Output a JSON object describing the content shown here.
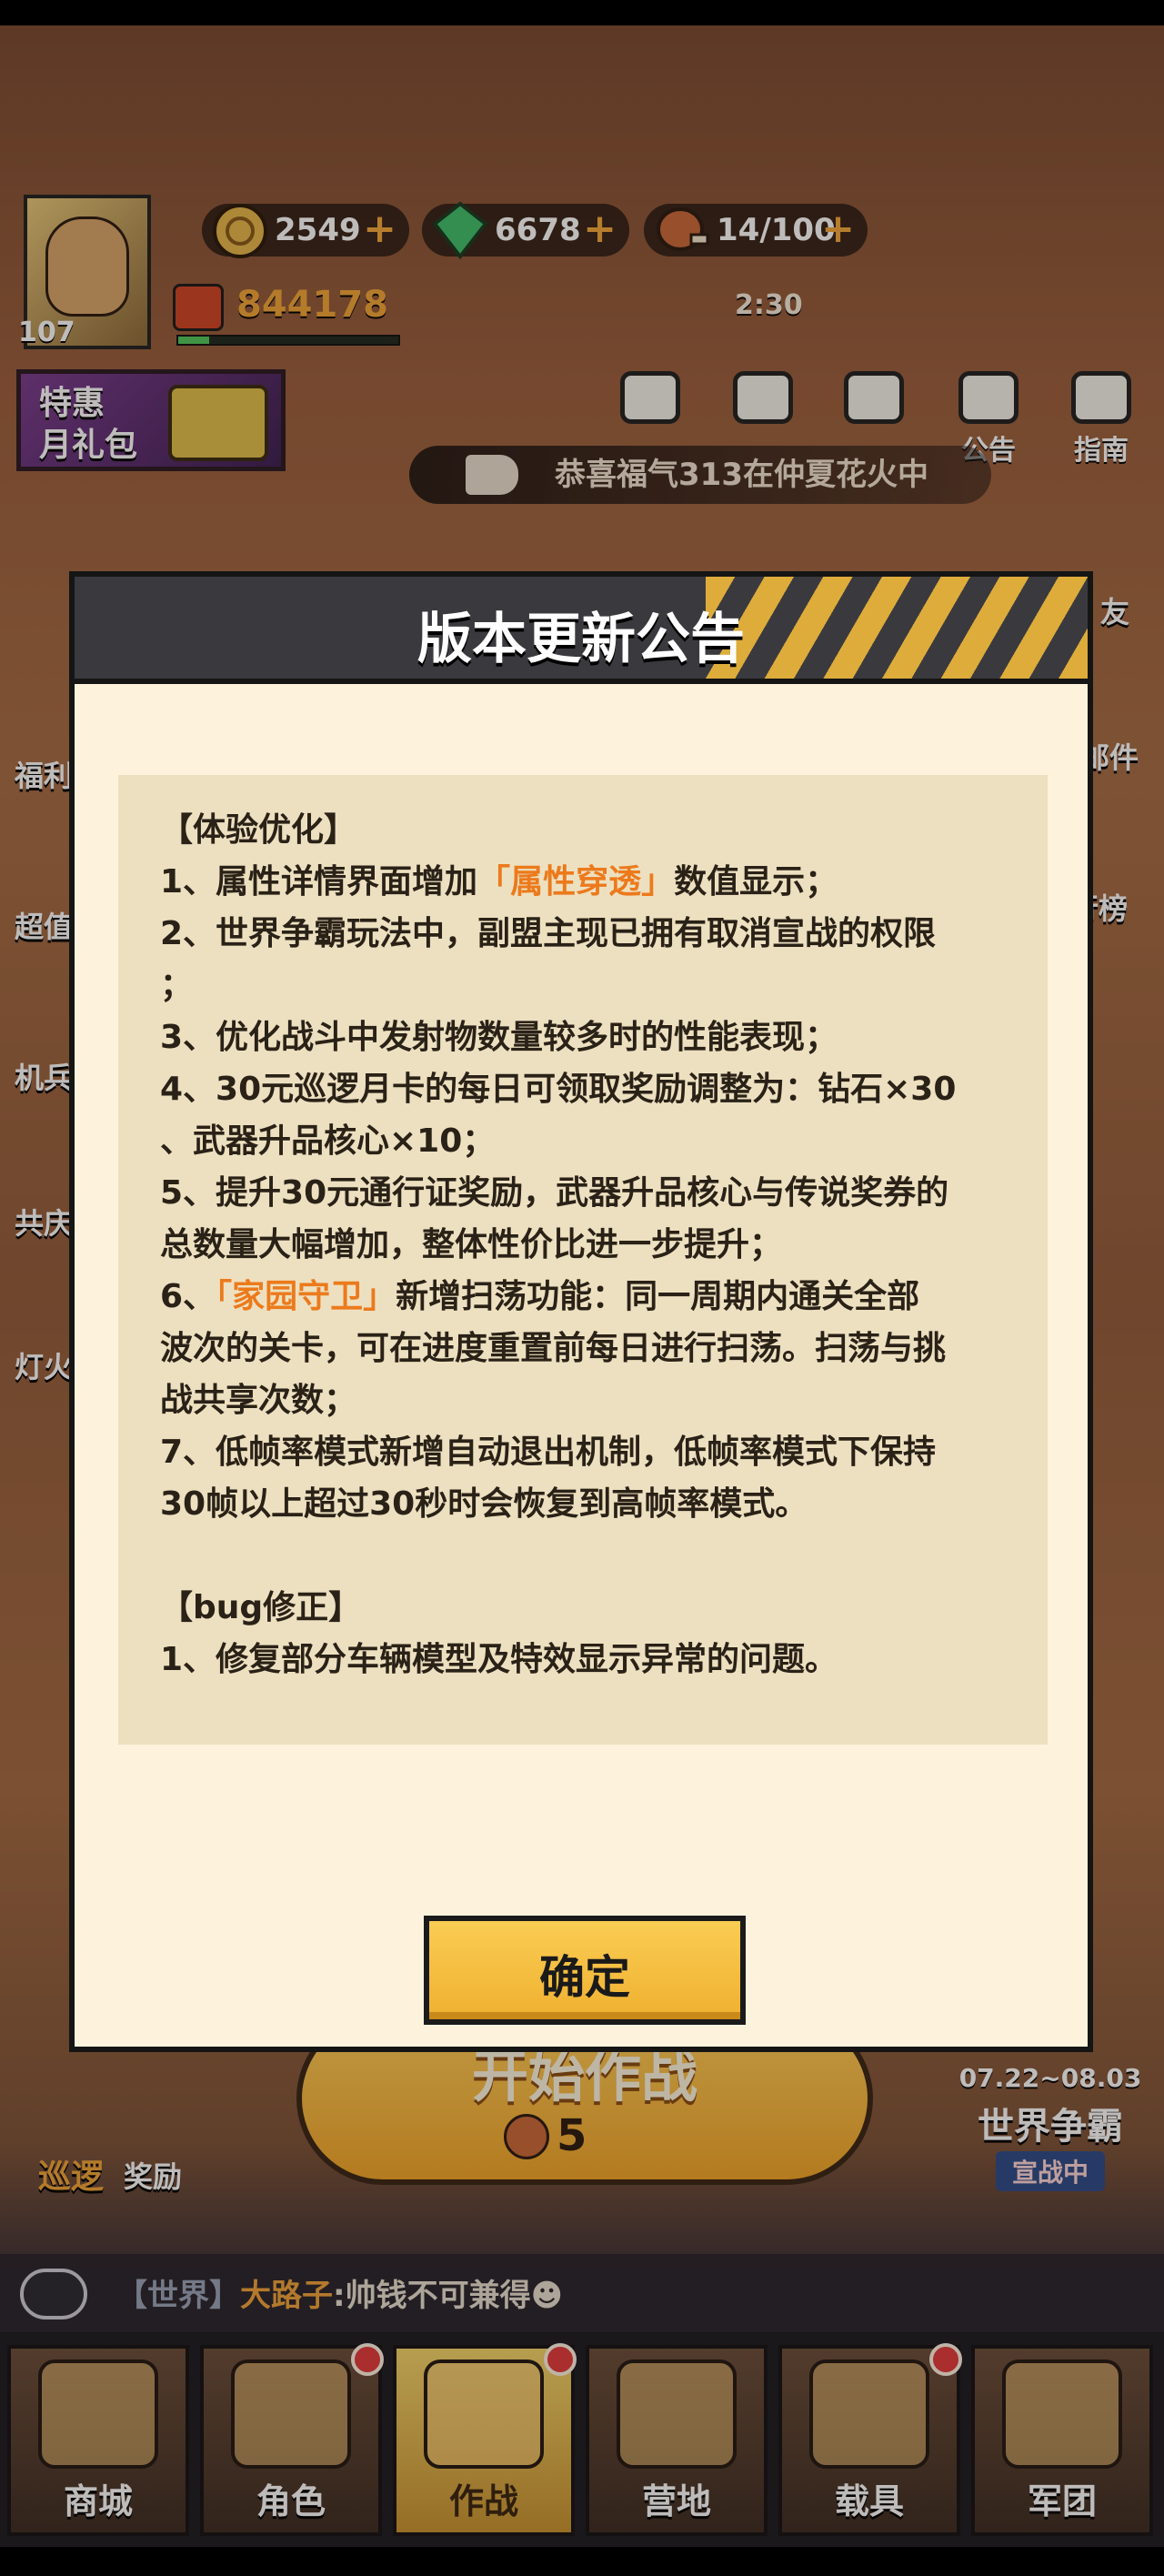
{
  "hud": {
    "player_level": "107",
    "coins": "2549",
    "gems": "6678",
    "stamina": "14/100",
    "stamina_timer": "2:30",
    "combat_power": "844178",
    "exp_fraction": 0.14,
    "plus_symbol": "+"
  },
  "gift_pack": {
    "label": "特惠\n月礼包"
  },
  "top_icons": [
    {
      "label": "",
      "icon": "pack-icon"
    },
    {
      "label": "",
      "icon": "backpack-icon"
    },
    {
      "label": "",
      "icon": "gamepad-icon"
    },
    {
      "label": "公告",
      "icon": "megaphone-icon"
    },
    {
      "label": "指南",
      "icon": "guide-icon"
    }
  ],
  "ticker": {
    "prefix": "恭喜福气313在仲夏花火中",
    "icon": "speaker-icon"
  },
  "side_left": [
    "福利",
    "超值",
    "机兵",
    "共庆",
    "灯火"
  ],
  "side_right": [
    "友",
    "邮件",
    "行榜"
  ],
  "modal": {
    "title": "版本更新公告",
    "lines": [
      {
        "text": "【体验优化】"
      },
      {
        "pre": "1、属性详情界面增加",
        "hl": "「属性穿透」",
        "post": "数值显示；"
      },
      {
        "text": "2、世界争霸玩法中，副盟主现已拥有取消宣战的权限"
      },
      {
        "text": "；"
      },
      {
        "text": "3、优化战斗中发射物数量较多时的性能表现；"
      },
      {
        "text": "4、30元巡逻月卡的每日可领取奖励调整为：钻石×30"
      },
      {
        "text": "、武器升品核心×10；"
      },
      {
        "text": "5、提升30元通行证奖励，武器升品核心与传说奖券的"
      },
      {
        "text": "总数量大幅增加，整体性价比进一步提升；"
      },
      {
        "pre": "6、",
        "hl": "「家园守卫」",
        "post": "新增扫荡功能：同一周期内通关全部"
      },
      {
        "text": "波次的关卡，可在进度重置前每日进行扫荡。扫荡与挑"
      },
      {
        "text": "战共享次数；"
      },
      {
        "text": "7、低帧率模式新增自动退出机制，低帧率模式下保持"
      },
      {
        "text": "30帧以上超过30秒时会恢复到高帧率模式。"
      },
      {
        "text": ""
      },
      {
        "text": "【bug修正】"
      },
      {
        "text": "1、修复部分车辆模型及特效显示异常的问题。"
      }
    ],
    "confirm_label": "确定"
  },
  "start_battle": {
    "label": "开始作战",
    "cost": "5"
  },
  "patrol": {
    "label_a": "巡逻",
    "label_b": "奖励"
  },
  "world_war": {
    "dates": "07.22~08.03",
    "title": "世界争霸",
    "status": "宣战中"
  },
  "chat": {
    "channel": "【世界】",
    "name": "大路子",
    "message": ":帅钱不可兼得☻"
  },
  "nav": [
    {
      "label": "商城",
      "badge": false,
      "active": false
    },
    {
      "label": "角色",
      "badge": true,
      "active": false
    },
    {
      "label": "作战",
      "badge": true,
      "active": true
    },
    {
      "label": "营地",
      "badge": false,
      "active": false
    },
    {
      "label": "载具",
      "badge": true,
      "active": false
    },
    {
      "label": "军团",
      "badge": false,
      "active": false
    }
  ],
  "colors": {
    "accent": "#f0b030",
    "highlight": "#ec7a1c",
    "panel": "#fdf3dd"
  }
}
